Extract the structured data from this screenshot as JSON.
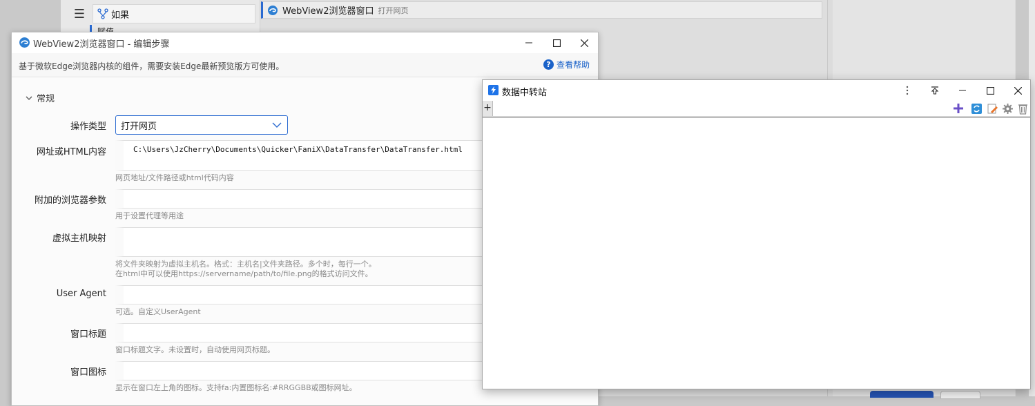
{
  "background": {
    "tree_items": [
      {
        "label": "如果"
      },
      {
        "label": "赋值"
      }
    ],
    "step": {
      "title": "WebView2浏览器窗口",
      "subtitle": "打开网页"
    }
  },
  "dialog": {
    "title": "WebView2浏览器窗口 - 编辑步骤",
    "description": "基于微软Edge浏览器内核的组件，需要安装Edge最新预览版方可使用。",
    "help_label": "查看帮助",
    "section_label": "常规",
    "fields": {
      "op_type": {
        "label": "操作类型",
        "value": "打开网页"
      },
      "url": {
        "label": "网址或HTML内容",
        "value": "C:\\Users\\JzCherry\\Documents\\Quicker\\FaniX\\DataTransfer\\DataTransfer.html",
        "hint": "网页地址/文件路径或html代码内容"
      },
      "browser_args": {
        "label": "附加的浏览器参数",
        "value": "",
        "hint": "用于设置代理等用途"
      },
      "host_map": {
        "label": "虚拟主机映射",
        "value": "",
        "hint_line1": "将文件夹映射为虚拟主机名。格式：主机名|文件夹路径。多个时，每行一个。",
        "hint_line2": "在html中可以使用https://servername/path/to/file.png的格式访问文件。"
      },
      "user_agent": {
        "label": "User Agent",
        "value": "",
        "hint": "可选。自定义UserAgent"
      },
      "window_title": {
        "label": "窗口标题",
        "value": "",
        "hint": "窗口标题文字。未设置时，自动使用网页标题。"
      },
      "window_icon": {
        "label": "窗口图标",
        "value": "",
        "hint": "显示在窗口左上角的图标。支持fa:内置图标名:#RRGGBB或图标网址。"
      }
    }
  },
  "transfer_window": {
    "title": "数据中转站",
    "tab_add": "+"
  }
}
